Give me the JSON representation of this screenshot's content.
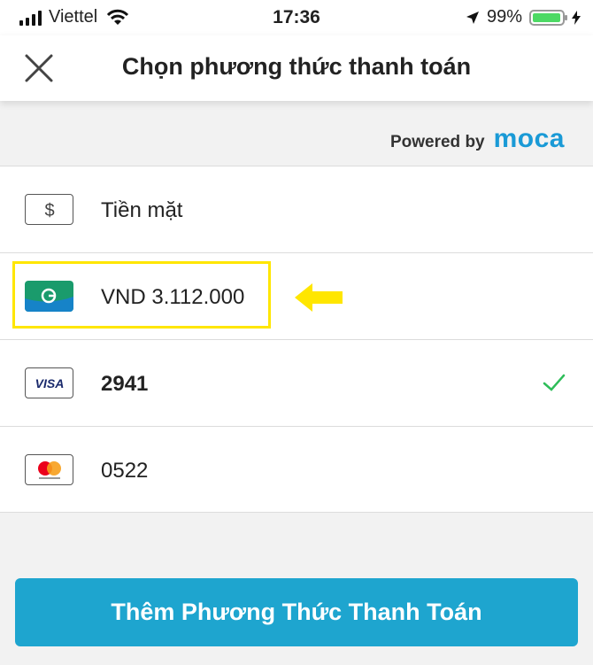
{
  "status_bar": {
    "carrier": "Viettel",
    "time": "17:36",
    "battery": "99%"
  },
  "header": {
    "title": "Chọn phương thức thanh toán"
  },
  "powered": {
    "prefix": "Powered by",
    "brand": "moca"
  },
  "payment_methods": [
    {
      "icon": "cash-icon",
      "label": "Tiền mặt",
      "selected": false
    },
    {
      "icon": "grabpay-icon",
      "label": "VND 3.112.000",
      "selected": false
    },
    {
      "icon": "visa-icon",
      "label": "2941",
      "selected": true
    },
    {
      "icon": "mastercard-icon",
      "label": "0522",
      "selected": false
    }
  ],
  "add_button": {
    "label": "Thêm Phương Thức Thanh Toán"
  },
  "colors": {
    "accent": "#1ea5cf",
    "brand": "#1a9ad6",
    "check": "#2ebd59",
    "highlight": "#ffe600"
  }
}
